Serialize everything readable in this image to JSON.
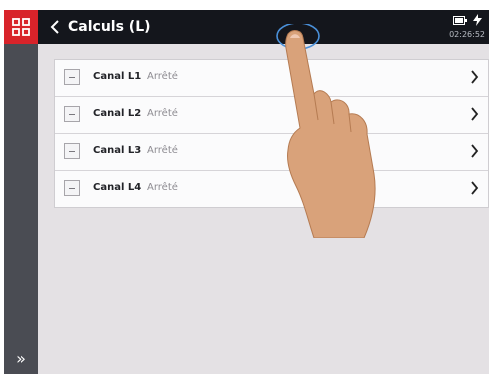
{
  "header": {
    "title": "Calculs (L)",
    "clock": "02:26:52",
    "apps_icon": "grid-icon",
    "back_icon": "chevron-left-icon",
    "battery_icon": "battery-icon",
    "charge_icon": "lightning-icon",
    "accent_color": "#d8232a"
  },
  "sidebar": {
    "expand_label": "»"
  },
  "channels": [
    {
      "name": "Canal L1",
      "status": "Arrêté"
    },
    {
      "name": "Canal L2",
      "status": "Arrêté"
    },
    {
      "name": "Canal L3",
      "status": "Arrêté"
    },
    {
      "name": "Canal L4",
      "status": "Arrêté"
    }
  ]
}
